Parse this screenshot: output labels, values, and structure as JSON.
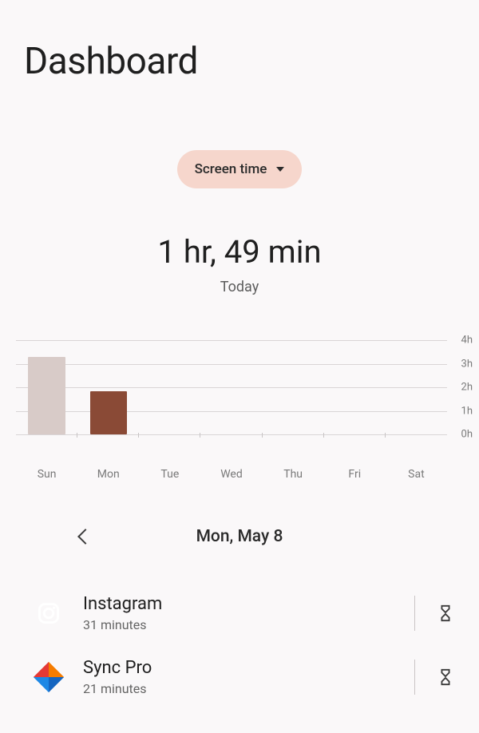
{
  "title": "Dashboard",
  "dropdown": {
    "label": "Screen time"
  },
  "summary": {
    "total": "1 hr, 49 min",
    "subtitle": "Today"
  },
  "chart_data": {
    "type": "bar",
    "categories": [
      "Sun",
      "Mon",
      "Tue",
      "Wed",
      "Thu",
      "Fri",
      "Sat"
    ],
    "values": [
      3.3,
      1.82,
      0,
      0,
      0,
      0,
      0
    ],
    "colors": [
      "#d8cbc8",
      "#8a4a36",
      "#d8cbc8",
      "#d8cbc8",
      "#d8cbc8",
      "#d8cbc8",
      "#d8cbc8"
    ],
    "title": "",
    "xlabel": "",
    "ylabel": "",
    "ylim": [
      0,
      4
    ],
    "yticks": [
      "0h",
      "1h",
      "2h",
      "3h",
      "4h"
    ]
  },
  "date_nav": {
    "label": "Mon, May 8"
  },
  "apps": [
    {
      "name": "Instagram",
      "time": "31 minutes",
      "icon": "instagram"
    },
    {
      "name": "Sync Pro",
      "time": "21 minutes",
      "icon": "syncpro"
    }
  ]
}
